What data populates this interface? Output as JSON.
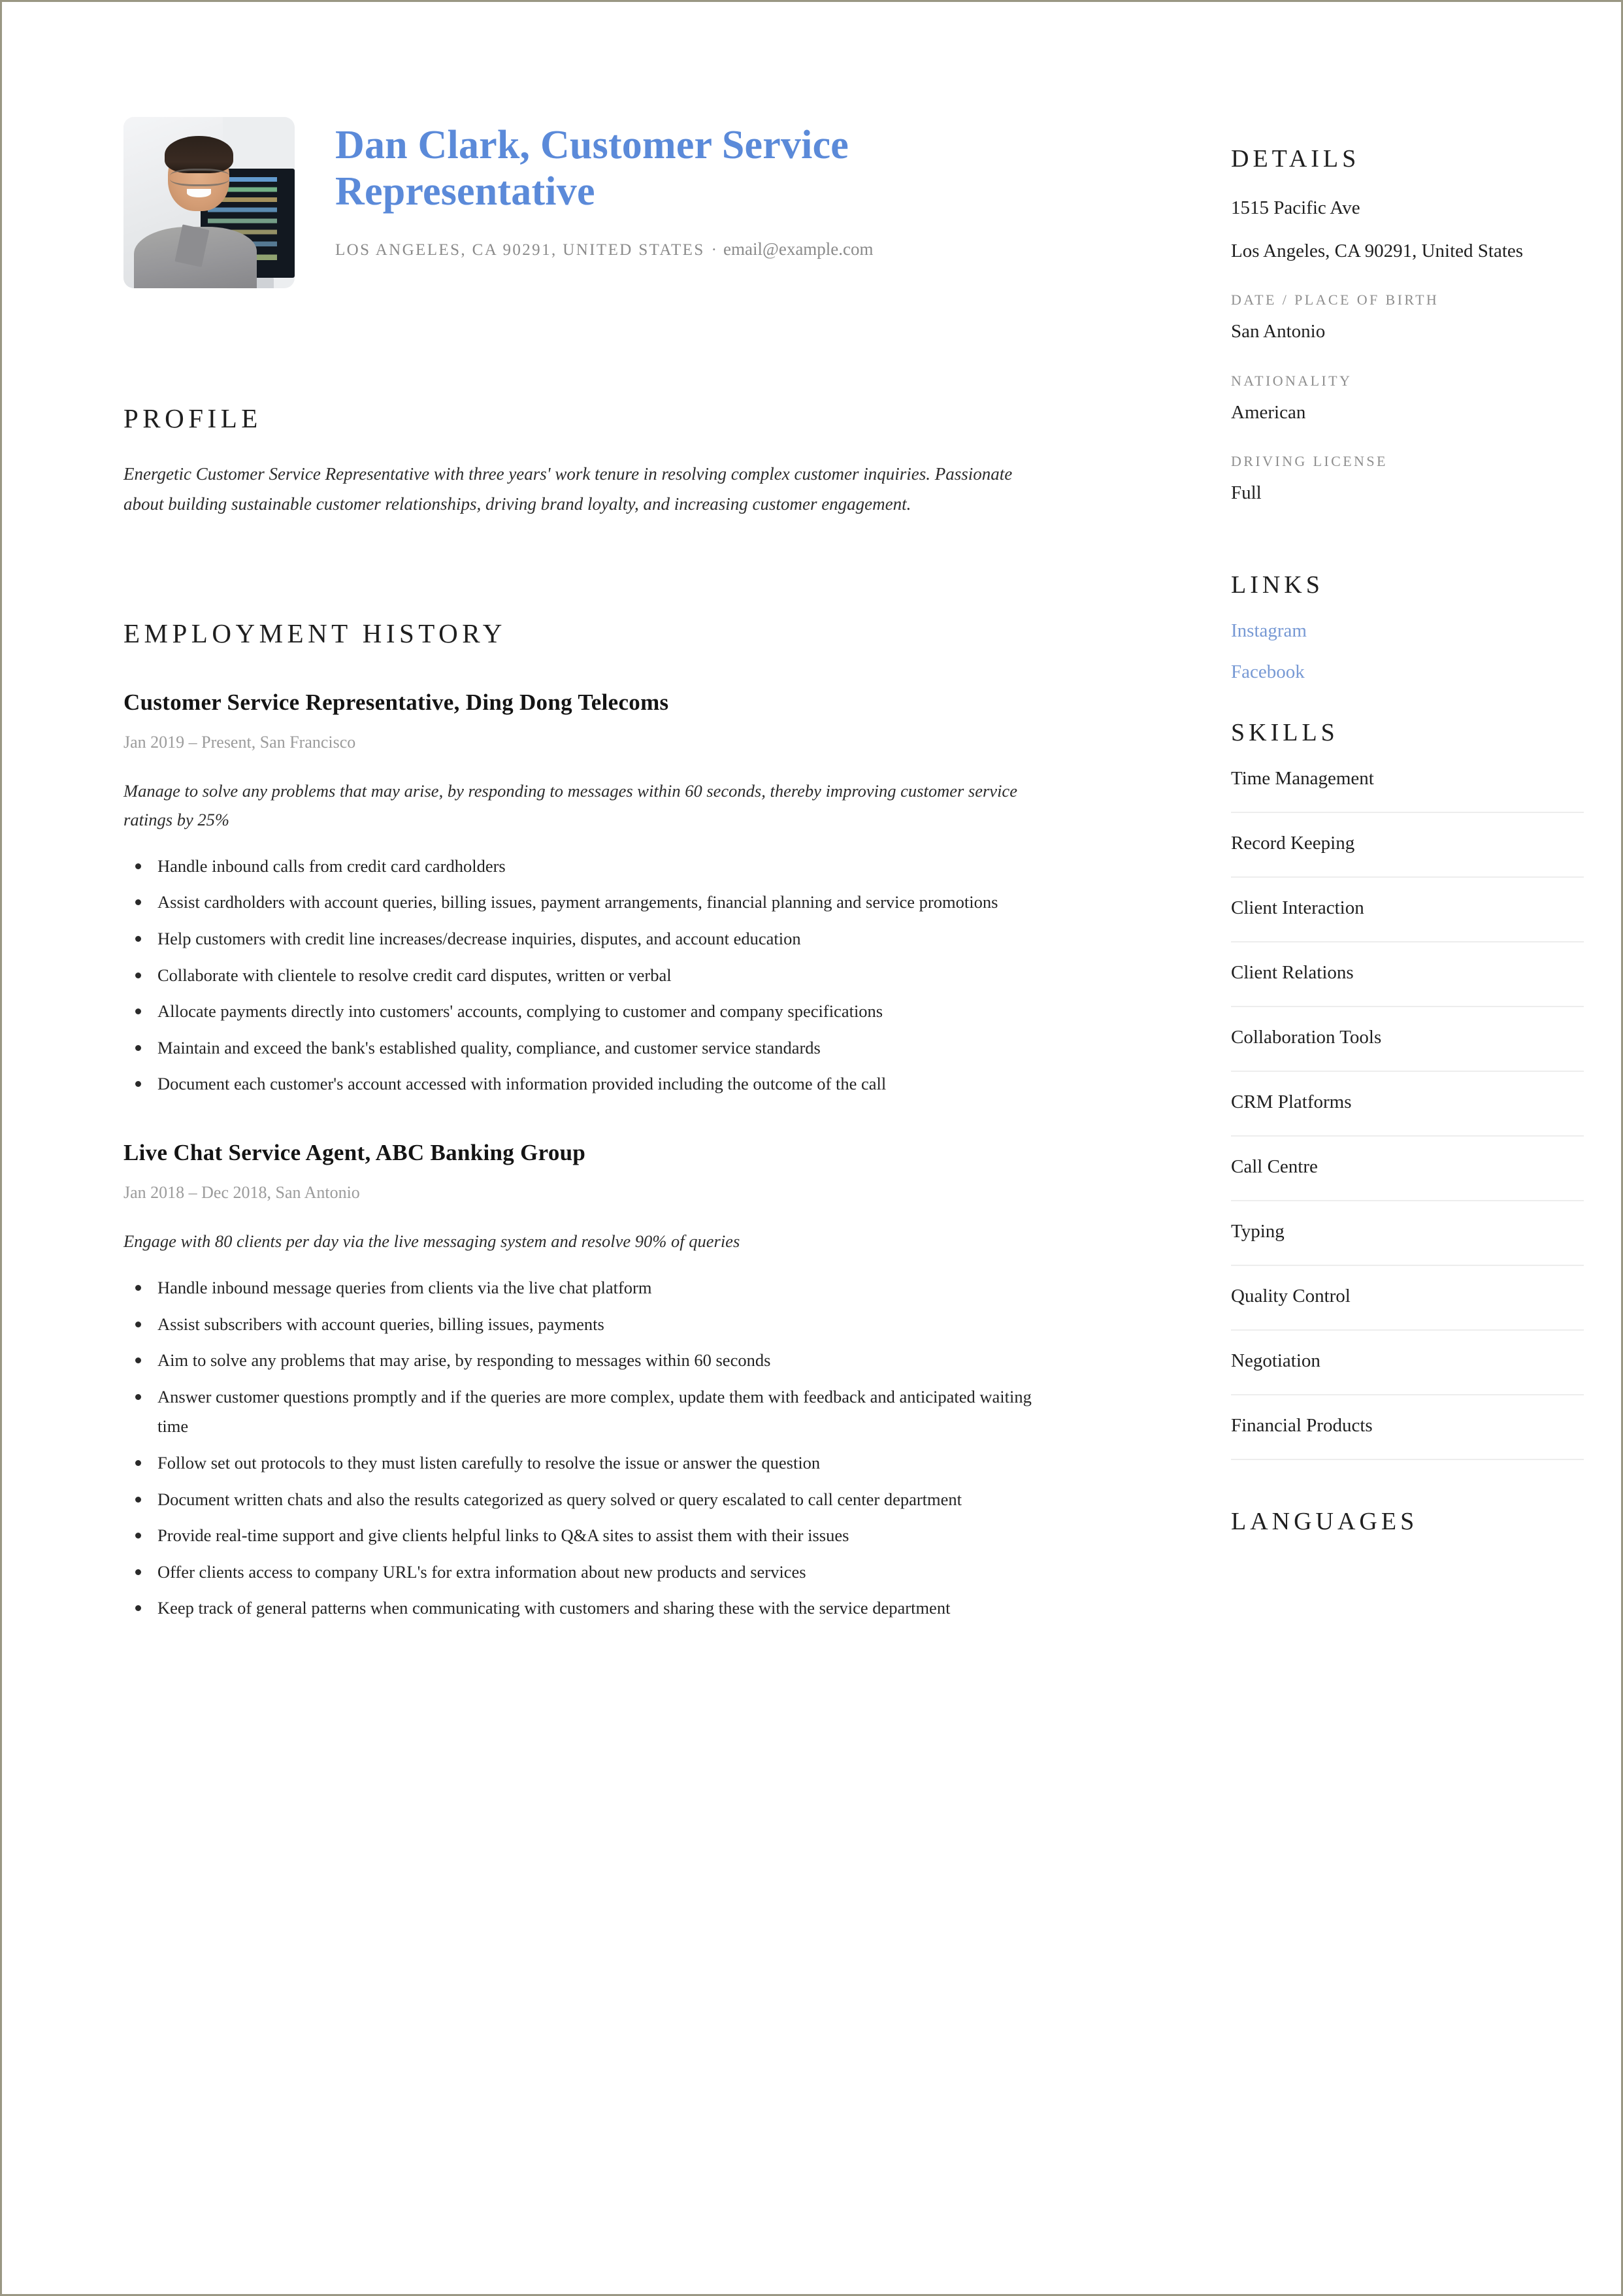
{
  "header": {
    "name": "Dan Clark, Customer Service Representative",
    "address": "LOS ANGELES, CA 90291, UNITED STATES",
    "separator": "·",
    "email": "email@example.com",
    "photo_alt": "portrait-photo"
  },
  "colors": {
    "name_blue": "#5b8ad9",
    "link_blue": "#7799d4",
    "text": "#1f1f1f",
    "muted": "#8e8e8e",
    "rule": "#ededed",
    "page_border": "#9a9784"
  },
  "sections": {
    "profile_title": "PROFILE",
    "employment_title": "EMPLOYMENT HISTORY"
  },
  "profile": {
    "text": "Energetic Customer Service Representative with three years' work tenure in resolving complex customer inquiries. Passionate about building sustainable customer relationships, driving brand loyalty, and increasing customer engagement."
  },
  "jobs": [
    {
      "title": "Customer Service Representative, Ding Dong Telecoms",
      "meta": "Jan 2019 – Present, San Francisco",
      "description": "Manage to solve any problems that may arise, by responding to messages within 60 seconds, thereby improving customer service ratings by 25%",
      "duties": [
        "Handle inbound calls from credit card cardholders",
        "Assist cardholders with account queries, billing issues, payment arrangements, financial planning and service promotions",
        "Help customers with credit line increases/decrease inquiries, disputes, and account education",
        "Collaborate with clientele to resolve credit card disputes, written or verbal",
        "Allocate payments directly into customers' accounts, complying to customer and company specifications",
        "Maintain and exceed the bank's established quality, compliance, and customer service standards",
        "Document each customer's account accessed with information provided including the outcome of the call"
      ]
    },
    {
      "title": "Live Chat Service Agent, ABC Banking Group",
      "meta": "Jan 2018 – Dec 2018, San Antonio",
      "description": "Engage with 80 clients per day via the live messaging system and resolve 90% of queries",
      "duties": [
        "Handle inbound message queries from clients via the live chat platform",
        "Assist subscribers with account queries, billing issues, payments",
        "Aim to solve any problems that may arise, by responding to messages within 60 seconds",
        "Answer customer questions promptly and if the queries are more complex, update them with feedback and anticipated waiting time",
        "Follow set out protocols to they must listen carefully to resolve the issue or answer the question",
        "Document written chats and also the results categorized as query solved or query escalated to call center department",
        "Provide real-time support and give clients helpful links to Q&A sites to assist them with their issues",
        "Offer clients access to company URL's for extra information about new products and services",
        "Keep track of general patterns when communicating with customers and sharing these with the service department"
      ]
    }
  ],
  "sidebar": {
    "details_title": "DETAILS",
    "address_line1": "1515 Pacific Ave",
    "address_line2": "Los Angeles, CA 90291, United States",
    "dob_label": "DATE / PLACE OF BIRTH",
    "dob_value": "San Antonio",
    "nationality_label": "NATIONALITY",
    "nationality_value": "American",
    "driving_label": "DRIVING LICENSE",
    "driving_value": "Full",
    "links_title": "LINKS",
    "links": [
      {
        "label": "Instagram"
      },
      {
        "label": "Facebook"
      }
    ],
    "skills_title": "SKILLS",
    "skills": [
      "Time Management",
      "Record Keeping",
      "Client Interaction",
      "Client Relations",
      "Collaboration Tools",
      "CRM Platforms",
      "Call Centre",
      "Typing",
      "Quality Control",
      "Negotiation",
      "Financial Products"
    ],
    "languages_title": "LANGUAGES"
  }
}
